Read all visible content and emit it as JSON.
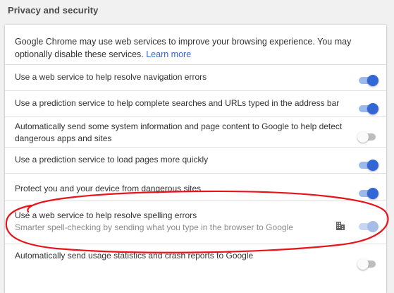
{
  "section": {
    "title": "Privacy and security"
  },
  "intro": {
    "text": "Google Chrome may use web services to improve your browsing experience. You may optionally disable these services.",
    "link_label": "Learn more"
  },
  "rows": [
    {
      "label": "Use a web service to help resolve navigation errors",
      "state": "on"
    },
    {
      "label": "Use a prediction service to help complete searches and URLs typed in the address bar",
      "state": "on"
    },
    {
      "label": "Automatically send some system information and page content to Google to help detect dangerous apps and sites",
      "state": "off"
    },
    {
      "label": "Use a prediction service to load pages more quickly",
      "state": "on"
    },
    {
      "label": "Protect you and your device from dangerous sites",
      "state": "on"
    },
    {
      "label": "Use a web service to help resolve spelling errors",
      "sublabel": "Smarter spell-checking by sending what you type in the browser to Google",
      "state": "on-disabled",
      "policy_icon": "enterprise-policy-icon"
    },
    {
      "label": "Automatically send usage statistics and crash reports to Google",
      "state": "off"
    }
  ],
  "colors": {
    "accent": "#3367d6",
    "annotation": "#e8141c"
  }
}
